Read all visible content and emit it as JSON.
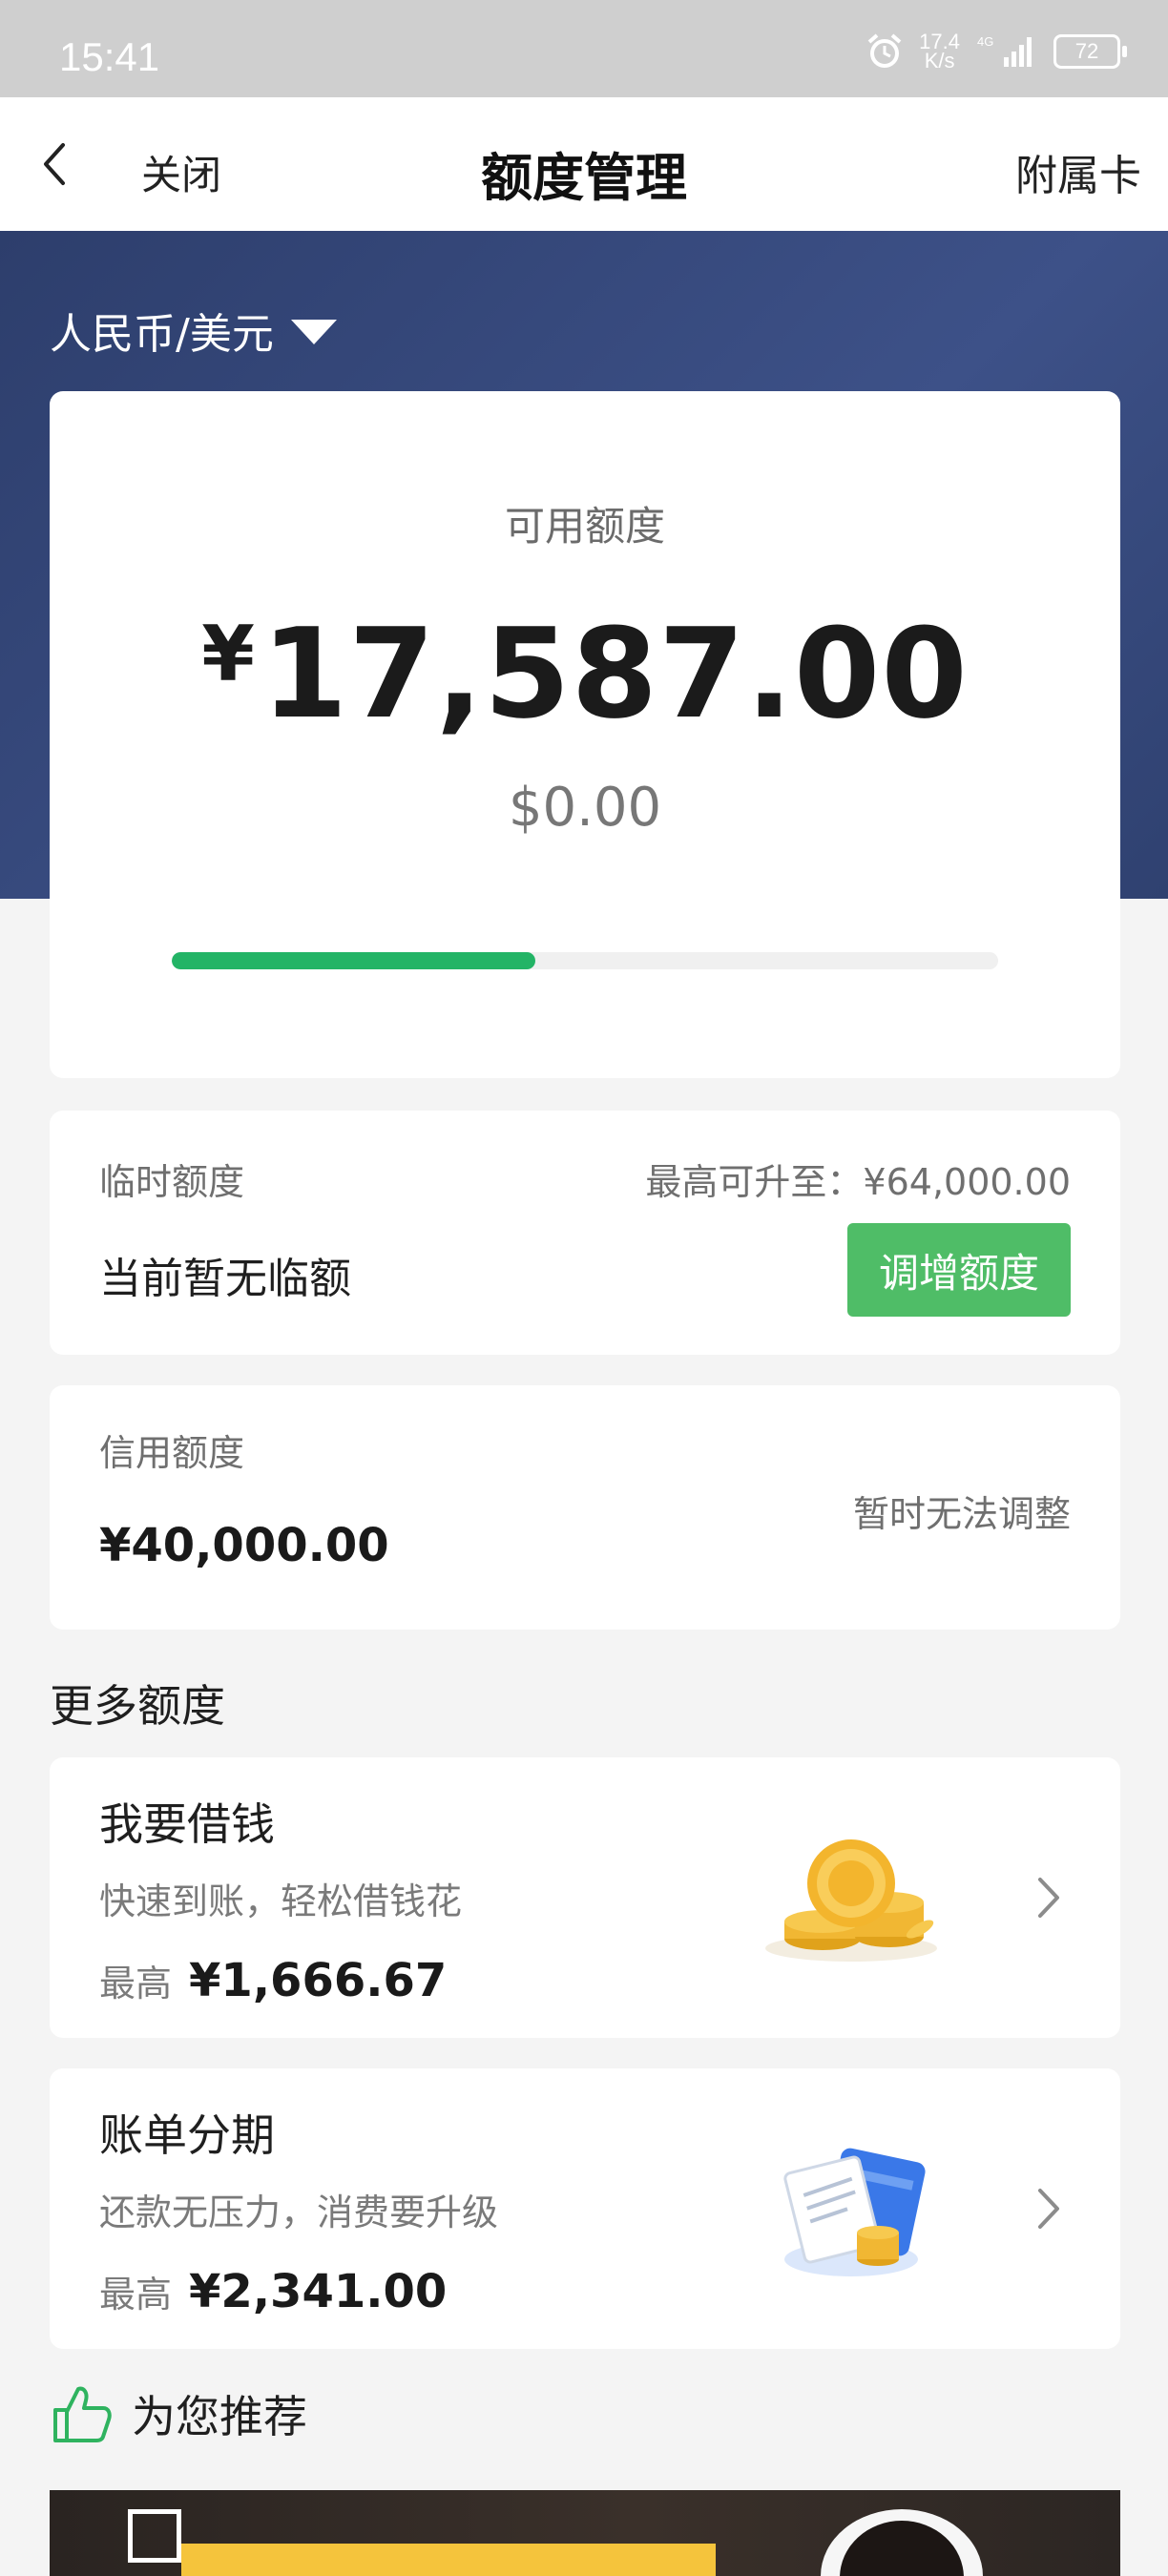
{
  "status_bar": {
    "time": "15:41",
    "net_speed_line1": "17.4",
    "net_speed_line2": "K/s",
    "battery": "72"
  },
  "nav": {
    "close_label": "关闭",
    "title": "额度管理",
    "right_label": "附属卡"
  },
  "currency": {
    "selected": "人民币/美元"
  },
  "available": {
    "label": "可用额度",
    "currency_symbol": "¥",
    "amount": "17,587.00",
    "usd_amount": "$0.00",
    "used_fraction": 0.44
  },
  "temporary": {
    "label": "临时额度",
    "max_text": "最高可升至：¥64,000.00",
    "status": "当前暂无临额",
    "button_label": "调增额度"
  },
  "credit": {
    "label": "信用额度",
    "amount": "¥40,000.00",
    "note": "暂时无法调整"
  },
  "more_section": {
    "title": "更多额度",
    "items": [
      {
        "title": "我要借钱",
        "desc": "快速到账，轻松借钱花",
        "max_label": "最高",
        "max_value": "¥1,666.67",
        "icon": "gold-coins-icon"
      },
      {
        "title": "账单分期",
        "desc": "还款无压力，消费要升级",
        "max_label": "最高",
        "max_value": "¥2,341.00",
        "icon": "bill-card-coins-icon"
      }
    ]
  },
  "recommend": {
    "title": "为您推荐",
    "icon": "thumbs-up-icon"
  },
  "colors": {
    "accent_green": "#23b466",
    "button_green": "#4fbd67",
    "hero_blue": "#34477a"
  }
}
